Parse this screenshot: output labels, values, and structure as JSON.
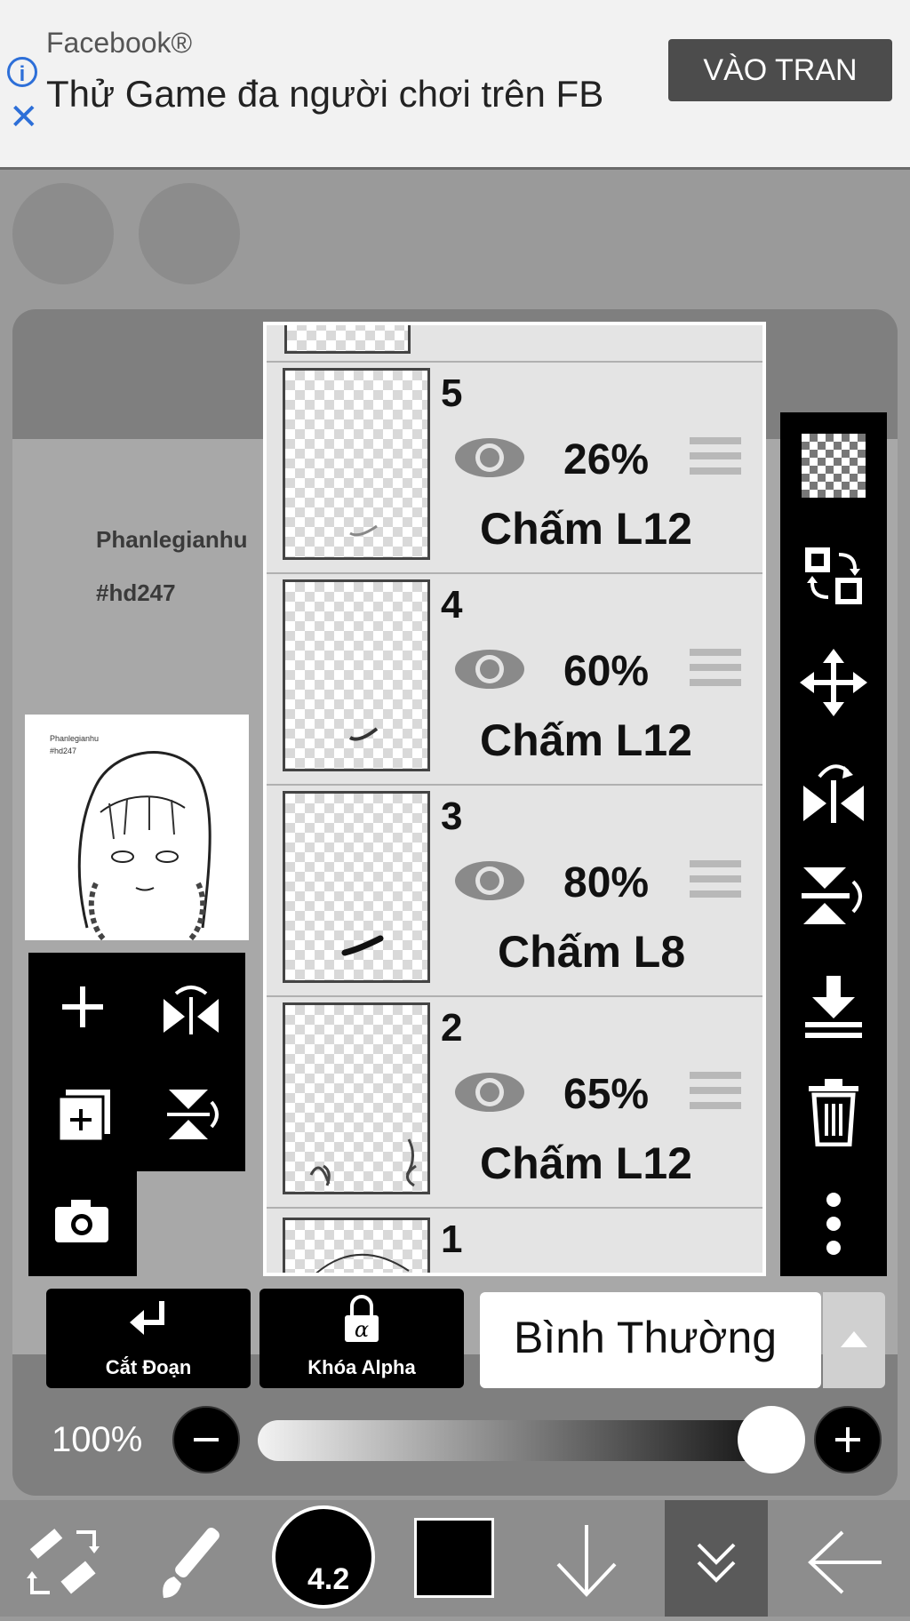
{
  "ad": {
    "source": "Facebook®",
    "text": "Thử Game đa người chơi trên FB",
    "cta": "VÀO TRAN"
  },
  "canvas": {
    "text_line1": "Phanlegianhu",
    "text_line2": "#hd247",
    "thumb_line1": "Phanlegianhu",
    "thumb_line2": "#hd247"
  },
  "layers": [
    {
      "number": "5",
      "opacity": "26%",
      "blend": "Chấm L12"
    },
    {
      "number": "4",
      "opacity": "60%",
      "blend": "Chấm L12"
    },
    {
      "number": "3",
      "opacity": "80%",
      "blend": "Chấm L8"
    },
    {
      "number": "2",
      "opacity": "65%",
      "blend": "Chấm L12"
    },
    {
      "number": "1",
      "opacity": "",
      "blend": ""
    }
  ],
  "actions": {
    "clip_label": "Cắt Đoạn",
    "alpha_lock_label": "Khóa Alpha",
    "blend_mode": "Bình Thường"
  },
  "opacity": {
    "label": "100%",
    "value": 1.0
  },
  "brush": {
    "size": "4.2"
  },
  "colors": {
    "foreground": "#000000",
    "panel_bg": "#7f7f7f",
    "ad_cta": "#4c4c4c"
  },
  "icons": {
    "left_tools": [
      "plus-icon",
      "flip-horizontal-icon",
      "add-copy-icon",
      "flip-vertical-icon",
      "camera-icon"
    ],
    "right_tools": [
      "transparency-icon",
      "swap-layer-icon",
      "move-icon",
      "flip-horizontal-icon",
      "flip-vertical-icon",
      "merge-down-icon",
      "trash-icon",
      "more-vertical-icon"
    ],
    "bottom": [
      "tool-switch-icon",
      "brush-icon",
      "brush-size",
      "color-swatch",
      "down-arrow-icon",
      "collapse-icon",
      "back-arrow-icon"
    ]
  }
}
